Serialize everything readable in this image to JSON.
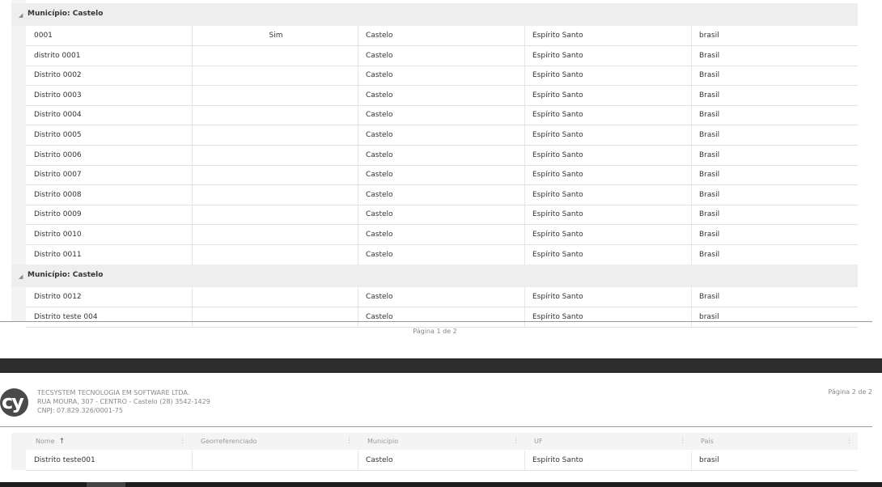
{
  "page1": {
    "groups": [
      {
        "label": "Município: Castelo",
        "rows": [
          {
            "nome": "0001",
            "geo": "Sim",
            "municipio": "Castelo",
            "uf": "Espírito Santo",
            "pais": "brasil"
          },
          {
            "nome": "distrito 0001",
            "geo": "",
            "municipio": "Castelo",
            "uf": "Espírito Santo",
            "pais": "Brasil"
          },
          {
            "nome": "Distrito 0002",
            "geo": "",
            "municipio": "Castelo",
            "uf": "Espírito Santo",
            "pais": "Brasil"
          },
          {
            "nome": "Distrito 0003",
            "geo": "",
            "municipio": "Castelo",
            "uf": "Espírito Santo",
            "pais": "Brasil"
          },
          {
            "nome": "Distrito 0004",
            "geo": "",
            "municipio": "Castelo",
            "uf": "Espírito Santo",
            "pais": "Brasil"
          },
          {
            "nome": "Distrito 0005",
            "geo": "",
            "municipio": "Castelo",
            "uf": "Espírito Santo",
            "pais": "Brasil"
          },
          {
            "nome": "Distrito 0006",
            "geo": "",
            "municipio": "Castelo",
            "uf": "Espírito Santo",
            "pais": "Brasil"
          },
          {
            "nome": "Distrito 0007",
            "geo": "",
            "municipio": "Castelo",
            "uf": "Espírito Santo",
            "pais": "Brasil"
          },
          {
            "nome": "Distrito 0008",
            "geo": "",
            "municipio": "Castelo",
            "uf": "Espírito Santo",
            "pais": "Brasil"
          },
          {
            "nome": "Distrito 0009",
            "geo": "",
            "municipio": "Castelo",
            "uf": "Espírito Santo",
            "pais": "Brasil"
          },
          {
            "nome": "Distrito 0010",
            "geo": "",
            "municipio": "Castelo",
            "uf": "Espírito Santo",
            "pais": "Brasil"
          },
          {
            "nome": "Distrito 0011",
            "geo": "",
            "municipio": "Castelo",
            "uf": "Espírito Santo",
            "pais": "Brasil"
          }
        ]
      },
      {
        "label": "Município: Castelo",
        "rows": [
          {
            "nome": "Distrito 0012",
            "geo": "",
            "municipio": "Castelo",
            "uf": "Espírito Santo",
            "pais": "Brasil"
          },
          {
            "nome": "Distrito teste 004",
            "geo": "",
            "municipio": "Castelo",
            "uf": "Espírito Santo",
            "pais": "brasil"
          }
        ]
      }
    ],
    "footer": "Página 1 de 2"
  },
  "page2": {
    "logo_text": "cy",
    "company": {
      "name": "TECSYSTEM TECNOLOGIA EM SOFTWARE LTDA.",
      "address": "RUA MOURA, 307 - CENTRO - Castelo (28) 3542-1429",
      "cnpj": "CNPJ: 07.829.326/0001-75"
    },
    "page_label": "Página 2 de 2",
    "columns": [
      "Nome",
      "Georreferenciado",
      "Município",
      "UF",
      "País"
    ],
    "sort_indicator": "↑",
    "rows": [
      {
        "nome": "Distrito teste001",
        "geo": "",
        "municipio": "Castelo",
        "uf": "Espírito Santo",
        "pais": "brasil"
      }
    ]
  },
  "colors": {
    "group_bg": "#eeeeee",
    "header_bg": "#f4f4f4",
    "dark_band": "#2d2d2d"
  }
}
